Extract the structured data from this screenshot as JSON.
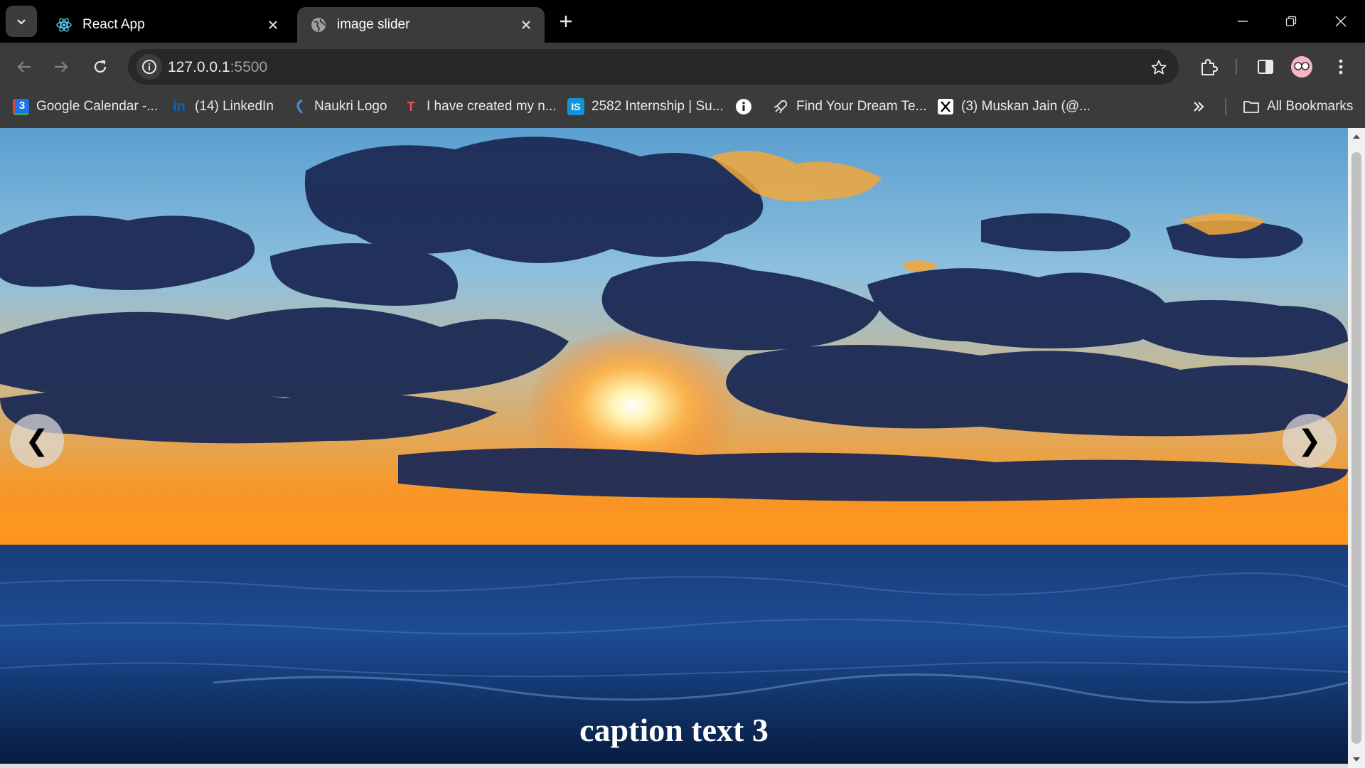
{
  "tabs": [
    {
      "title": "React App",
      "icon": "react-icon",
      "active": false
    },
    {
      "title": "image slider",
      "icon": "globe-icon",
      "active": true
    }
  ],
  "address": {
    "host": "127.0.0.1",
    "port": ":5500"
  },
  "bookmarks": [
    {
      "label": "Google Calendar -...",
      "icon": "google-calendar-icon"
    },
    {
      "label": "(14) LinkedIn",
      "icon": "linkedin-icon"
    },
    {
      "label": "Naukri Logo",
      "icon": "naukri-icon"
    },
    {
      "label": "I have created my n...",
      "icon": "bookmark-favicon-icon"
    },
    {
      "label": "2582 Internship | Su...",
      "icon": "internshala-icon"
    },
    {
      "label": "",
      "icon": "info-icon"
    },
    {
      "label": "Find Your Dream Te...",
      "icon": "rocket-icon"
    },
    {
      "label": "(3) Muskan Jain (@...",
      "icon": "x-icon"
    }
  ],
  "all_bookmarks": "All Bookmarks",
  "slider": {
    "prev": "❮",
    "next": "❯",
    "caption": "caption text 3"
  },
  "colors": {
    "titlebar": "#000000",
    "toolbar": "#3b3b3b",
    "omnibox": "#282828"
  }
}
